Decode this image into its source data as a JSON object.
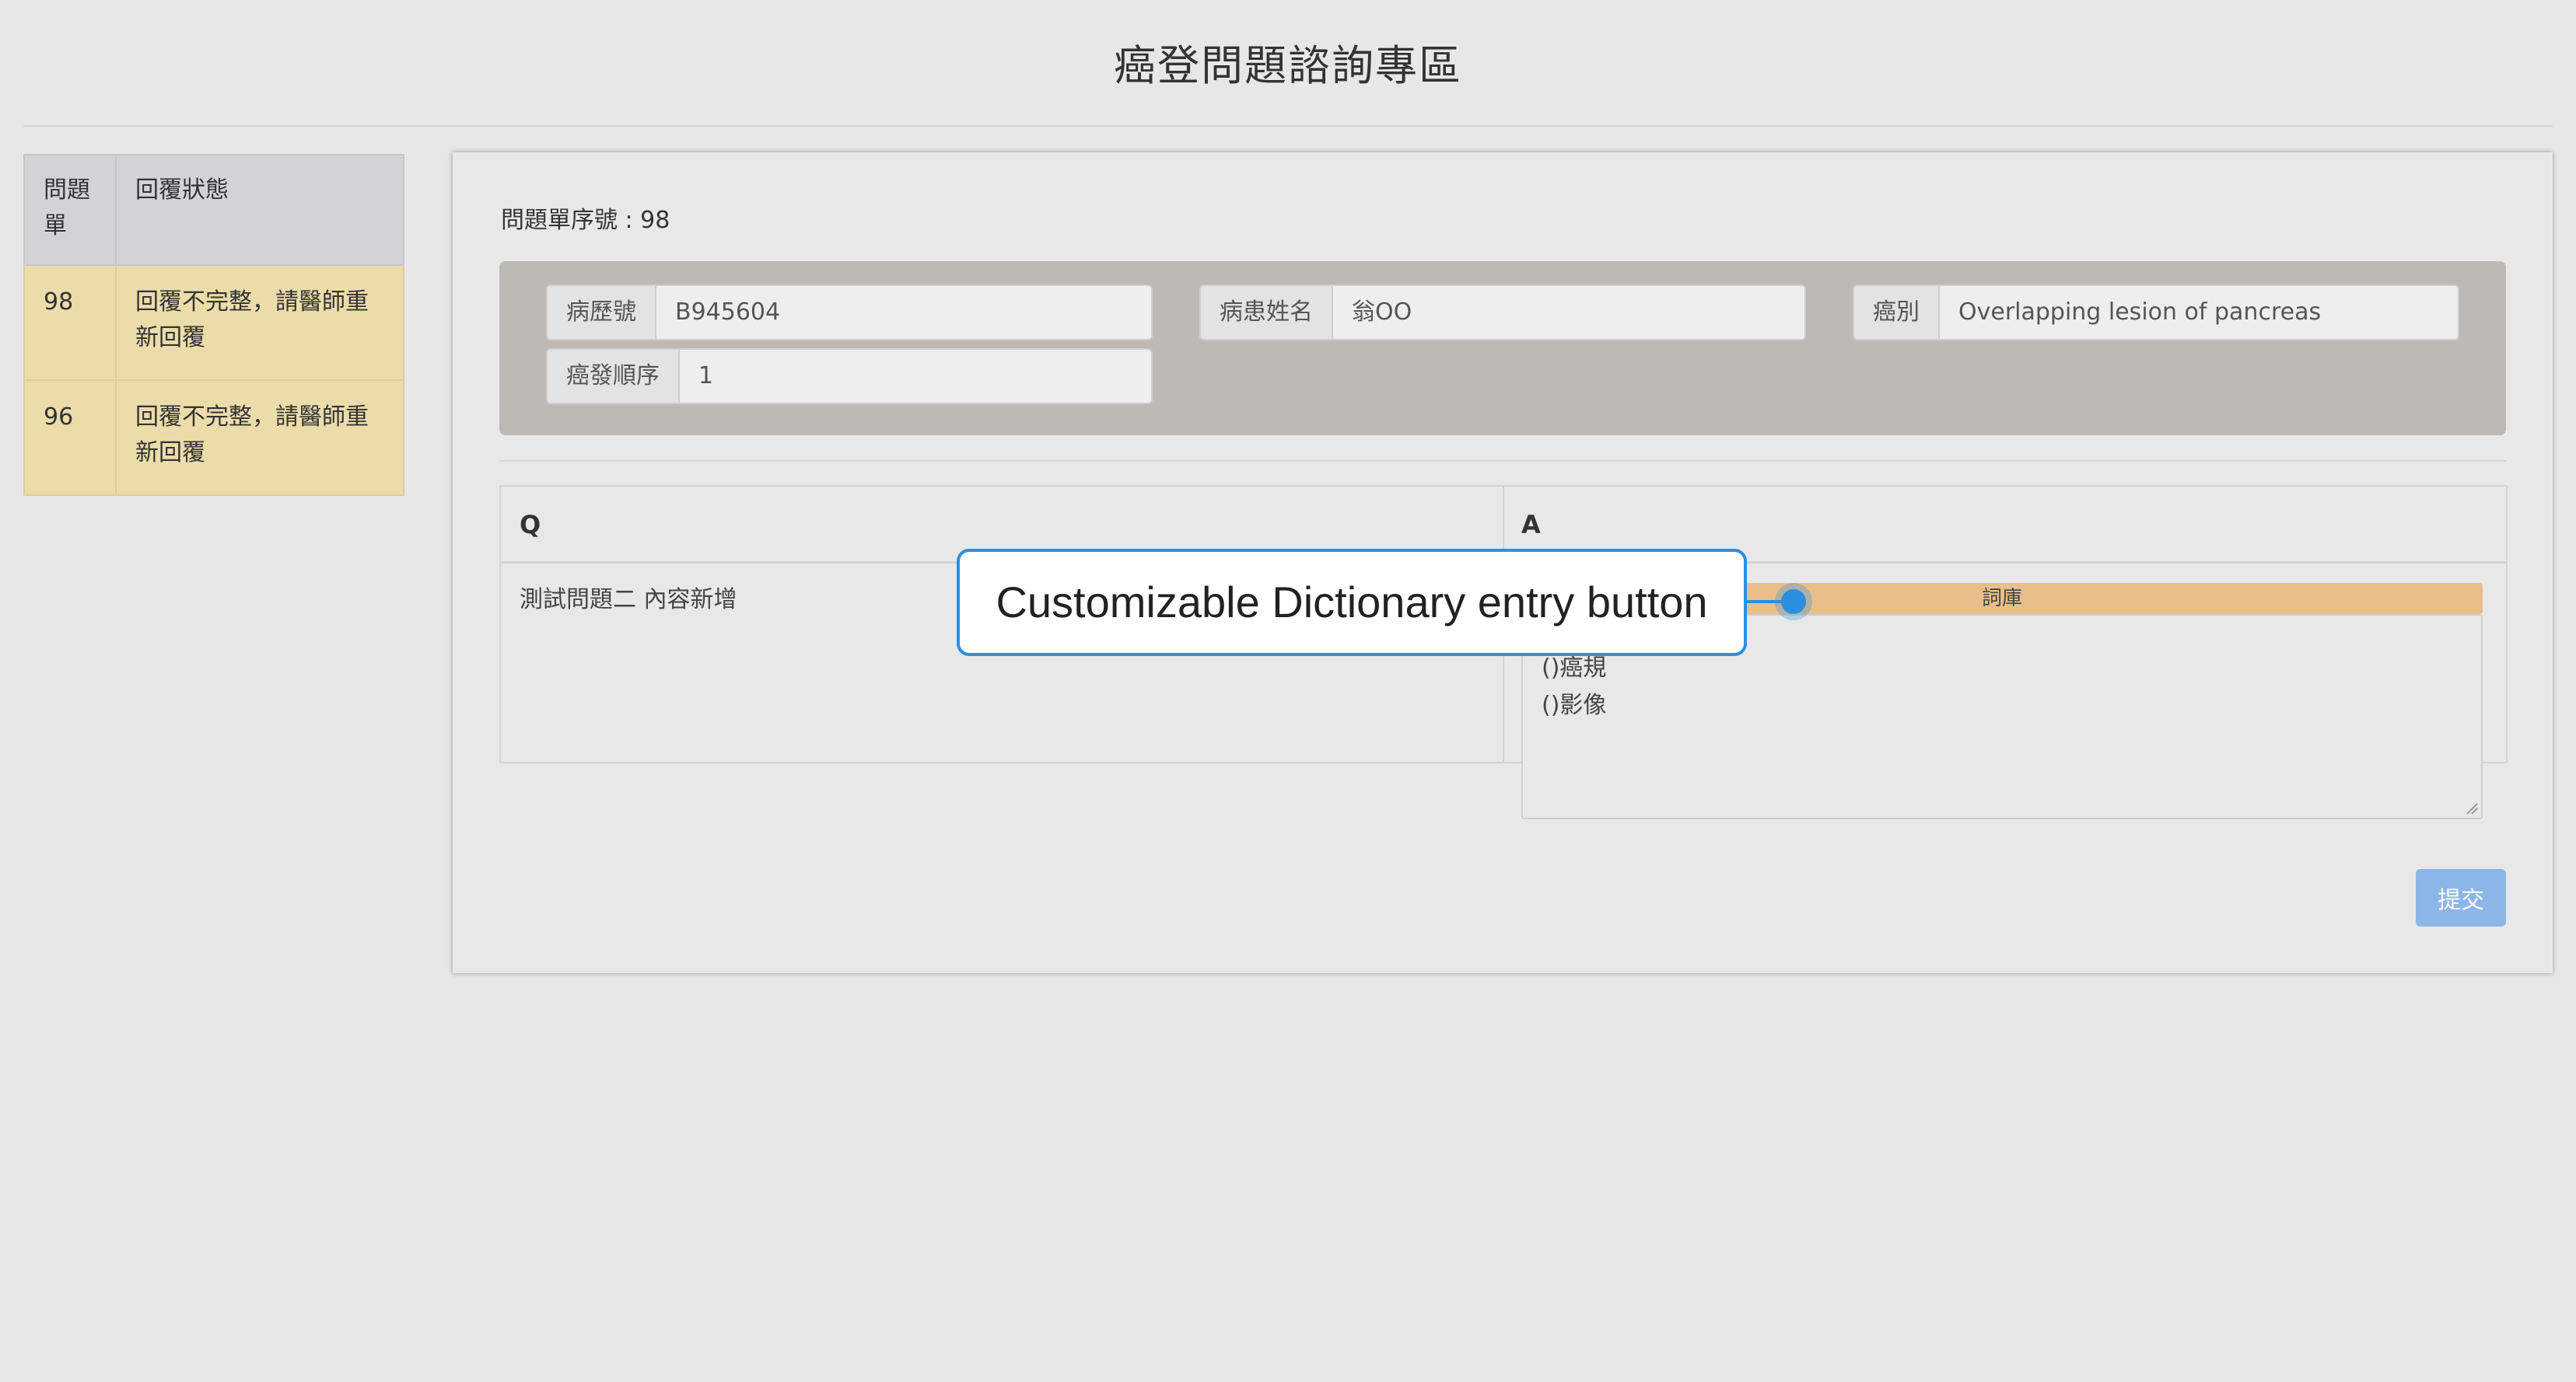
{
  "page": {
    "title": "癌登問題諮詢專區"
  },
  "sidebar": {
    "headers": [
      "問題單",
      "回覆狀態"
    ],
    "rows": [
      {
        "id": "98",
        "status": "回覆不完整，請醫師重新回覆"
      },
      {
        "id": "96",
        "status": "回覆不完整，請醫師重新回覆"
      }
    ]
  },
  "form": {
    "serial_label": "問題單序號 : 98",
    "fields": {
      "record_no": {
        "label": "病歷號",
        "value": "B945604"
      },
      "patient_name": {
        "label": "病患姓名",
        "value": "翁OO"
      },
      "cancer_type": {
        "label": "癌別",
        "value": "Overlapping lesion of pancreas"
      },
      "cancer_order": {
        "label": "癌發順序",
        "value": "1"
      }
    },
    "qa": {
      "q_header": "Q",
      "a_header": "A",
      "question": "測試問題二 內容新增",
      "dictionary_button": "詞庫",
      "answer_lines": [
        "()癌規",
        "()影像"
      ]
    },
    "submit_label": "提交"
  },
  "annotation": {
    "text": "Customizable Dictionary entry button"
  },
  "colors": {
    "background": "#e7e7e7",
    "info_box": "#bdbab6",
    "sidebar_row": "#ebdcaa",
    "dictionary_button": "#e8bf8a",
    "submit_button": "#8cb6e6",
    "callout_accent": "#2b8fe0"
  }
}
